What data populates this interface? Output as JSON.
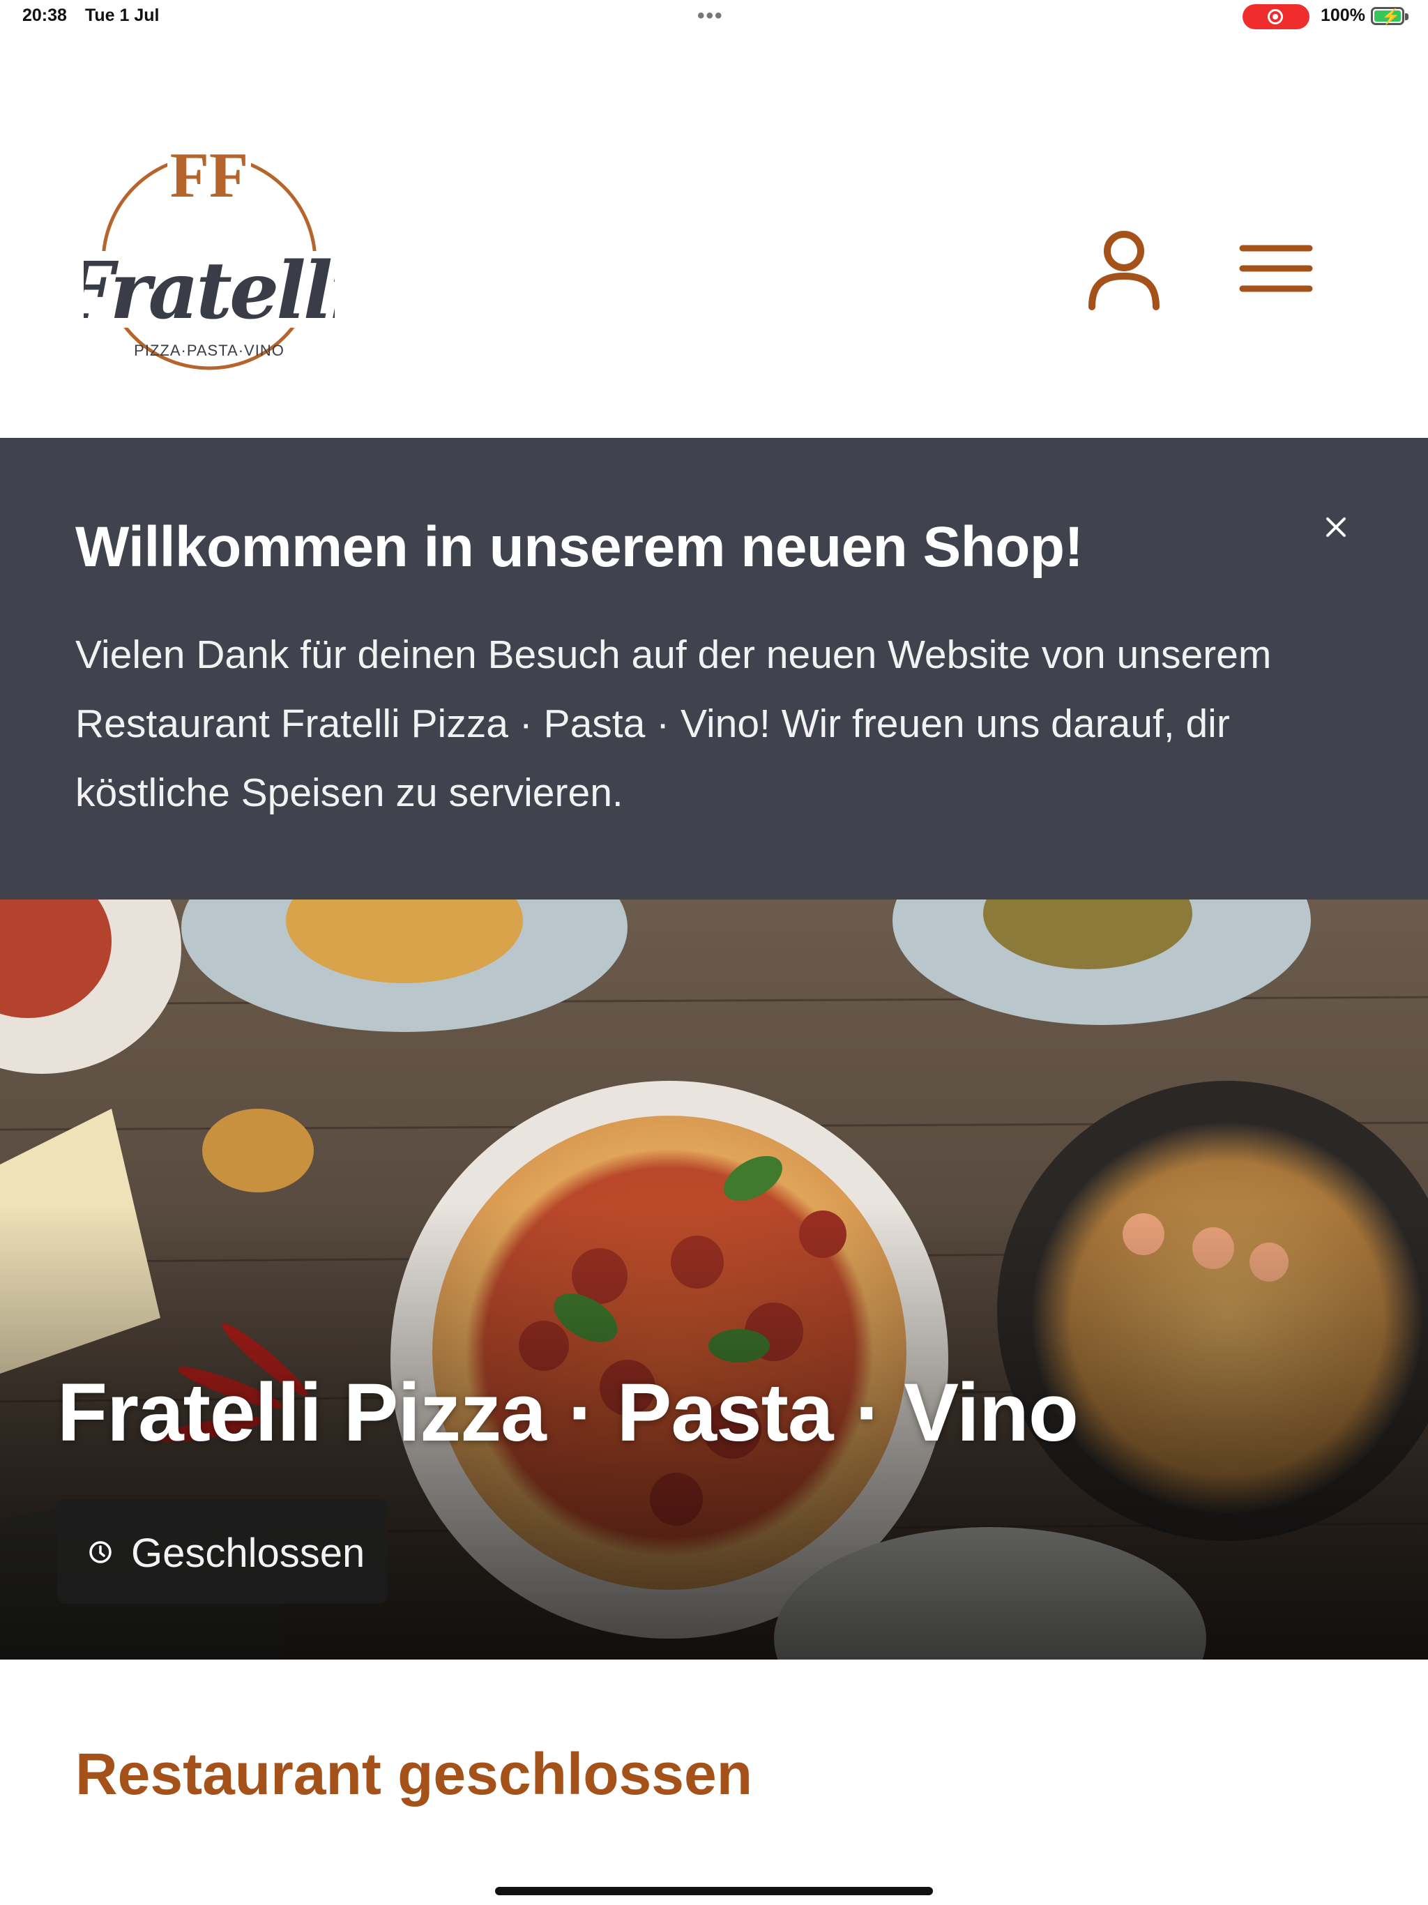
{
  "status_bar": {
    "time": "20:38",
    "date": "Tue 1 Jul",
    "dots": "•••",
    "battery_percent": "100%",
    "recording_color": "#ef2d2d",
    "battery_color": "#35c759"
  },
  "header": {
    "logo": {
      "monogram": "FF",
      "name": "Fratelli",
      "tagline": "PIZZA·PASTA·VINO"
    },
    "account_icon": "user-icon",
    "menu_icon": "hamburger-menu-icon",
    "accent_color": "#a4521a"
  },
  "banner": {
    "title": "Willkommen in unserem neuen Shop!",
    "text": "Vielen Dank für deinen Besuch auf der neuen Website von unserem Restaurant Fratelli Pizza · Pasta · Vino! Wir freuen uns darauf, dir köstliche Speisen zu servieren.",
    "close_icon": "close-icon",
    "background_color": "#40424d"
  },
  "hero": {
    "restaurant_name": "Fratelli Pizza · Pasta · Vino",
    "status_label": "Geschlossen",
    "status_icon": "clock-icon"
  },
  "main": {
    "closed_heading": "Restaurant geschlossen"
  }
}
